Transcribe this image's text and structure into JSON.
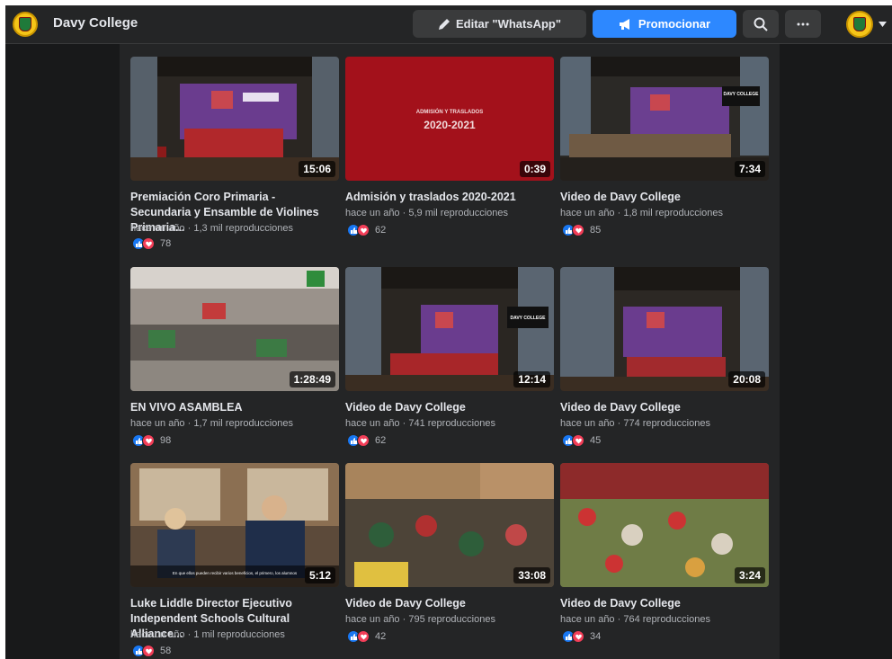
{
  "header": {
    "page_name": "Davy College",
    "edit_label": "Editar \"WhatsApp\"",
    "promote_label": "Promocionar"
  },
  "colors": {
    "accent": "#2d88ff",
    "background": "#18191a",
    "surface": "#242526",
    "like": "#1877f2",
    "love": "#f33e58"
  },
  "icons": {
    "edit": "pencil-icon",
    "promote": "megaphone-icon",
    "search": "search-icon",
    "more": "more-dots-icon",
    "account": "caret-down-icon"
  },
  "videos": [
    {
      "title": "Premiación Coro Primaria - Secundaria y Ensamble de Violines Primaria...",
      "time": "hace un año",
      "views": "1,3 mil reproducciones",
      "reactions": "78",
      "duration": "15:06",
      "thumb": "stage-choir"
    },
    {
      "title": "Admisión y traslados 2020-2021",
      "time": "hace un año",
      "views": "5,9 mil reproducciones",
      "reactions": "62",
      "duration": "0:39",
      "thumb": "red-title-card",
      "thumb_line1": "ADMISIÓN Y TRASLADOS",
      "thumb_line2": "2020-2021"
    },
    {
      "title": "Video de Davy College",
      "time": "hace un año",
      "views": "1,8 mil reproducciones",
      "reactions": "85",
      "duration": "7:34",
      "thumb": "stage-orchestra",
      "sign": "DAVY COLLEGE"
    },
    {
      "title": "EN VIVO ASAMBLEA",
      "time": "hace un año",
      "views": "1,7 mil reproducciones",
      "reactions": "98",
      "duration": "1:28:49",
      "thumb": "student-crowd"
    },
    {
      "title": "Video de Davy College",
      "time": "hace un año",
      "views": "741 reproducciones",
      "reactions": "62",
      "duration": "12:14",
      "thumb": "stage-choir-wide",
      "sign": "DAVY COLLEGE"
    },
    {
      "title": "Video de Davy College",
      "time": "hace un año",
      "views": "774 reproducciones",
      "reactions": "45",
      "duration": "20:08",
      "thumb": "stage-choir"
    },
    {
      "title": "Luke Liddle Director Ejecutivo Independent Schools Cultural Alliance...",
      "time": "hace un año",
      "views": "1 mil reproducciones",
      "reactions": "58",
      "duration": "5:12",
      "thumb": "interview",
      "subtitle": "En que ellos pueden recibir varios beneficios, el primero, los alumnos"
    },
    {
      "title": "Video de Davy College",
      "time": "hace un año",
      "views": "795 reproducciones",
      "reactions": "42",
      "duration": "33:08",
      "thumb": "children-library"
    },
    {
      "title": "Video de Davy College",
      "time": "hace un año",
      "views": "764 reproducciones",
      "reactions": "34",
      "duration": "3:24",
      "thumb": "children-outdoor"
    }
  ]
}
